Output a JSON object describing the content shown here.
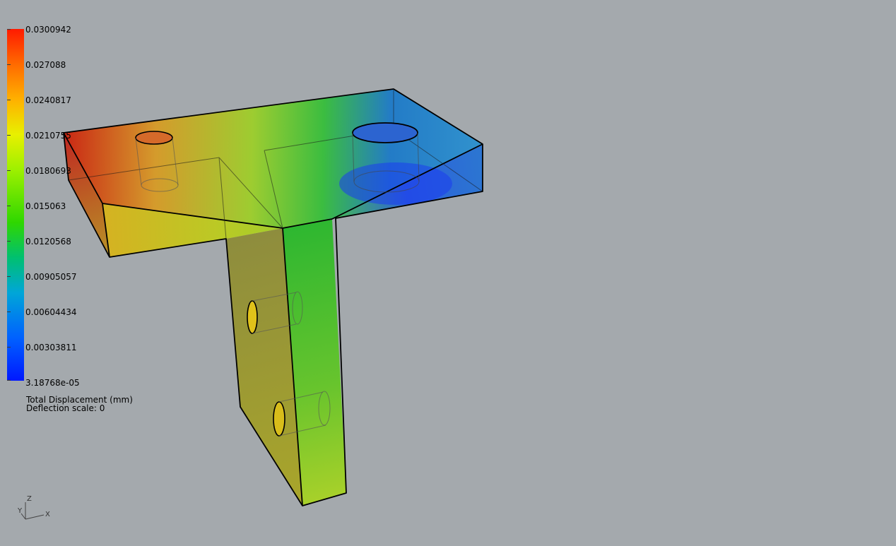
{
  "legend": {
    "ticks": [
      "0.0300942",
      "0.027088",
      "0.0240817",
      "0.0210755",
      "0.0180693",
      "0.015063",
      "0.0120568",
      "0.00905057",
      "0.00604434",
      "0.00303811",
      "3.18768e-05"
    ],
    "title": "Total Displacement (mm)",
    "deflection": "Deflection scale: 0"
  },
  "triad": {
    "z": "Z",
    "y": "Y",
    "x": "X"
  },
  "colors": {
    "background": "#a4a9ad",
    "max": "#ff1a00",
    "min": "#0018ff",
    "mid": "#2fd700"
  }
}
